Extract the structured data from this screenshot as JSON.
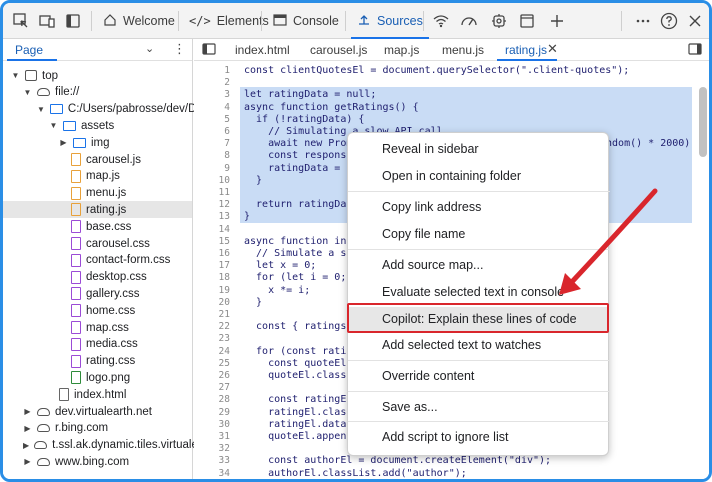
{
  "toolbar": {
    "tabs": [
      {
        "label": "Welcome",
        "icon": "home-icon"
      },
      {
        "label": "Elements",
        "icon": "code-icon"
      },
      {
        "label": "Console",
        "icon": "console-icon"
      },
      {
        "label": "Sources",
        "icon": "sources-icon"
      }
    ],
    "active_tab": "Sources"
  },
  "sidebar": {
    "page_label": "Page",
    "tree": [
      {
        "label": "top",
        "type": "frame",
        "depth": 0,
        "expanded": true
      },
      {
        "label": "file://",
        "type": "cloud",
        "depth": 1,
        "expanded": true
      },
      {
        "label": "C:/Users/pabrosse/dev/Demo",
        "type": "folder",
        "depth": 2,
        "expanded": true
      },
      {
        "label": "assets",
        "type": "folder",
        "depth": 3,
        "expanded": true
      },
      {
        "label": "img",
        "type": "folder",
        "depth": 4,
        "expanded": false
      },
      {
        "label": "carousel.js",
        "type": "js",
        "depth": 5
      },
      {
        "label": "map.js",
        "type": "js",
        "depth": 5
      },
      {
        "label": "menu.js",
        "type": "js",
        "depth": 5
      },
      {
        "label": "rating.js",
        "type": "js",
        "depth": 5,
        "selected": true
      },
      {
        "label": "base.css",
        "type": "css",
        "depth": 5
      },
      {
        "label": "carousel.css",
        "type": "css",
        "depth": 5
      },
      {
        "label": "contact-form.css",
        "type": "css",
        "depth": 5
      },
      {
        "label": "desktop.css",
        "type": "css",
        "depth": 5
      },
      {
        "label": "gallery.css",
        "type": "css",
        "depth": 5
      },
      {
        "label": "home.css",
        "type": "css",
        "depth": 5
      },
      {
        "label": "map.css",
        "type": "css",
        "depth": 5
      },
      {
        "label": "media.css",
        "type": "css",
        "depth": 5
      },
      {
        "label": "rating.css",
        "type": "css",
        "depth": 5
      },
      {
        "label": "logo.png",
        "type": "img",
        "depth": 5
      },
      {
        "label": "index.html",
        "type": "html",
        "depth": 4
      },
      {
        "label": "dev.virtualearth.net",
        "type": "cloud",
        "depth": 1,
        "expanded": false
      },
      {
        "label": "r.bing.com",
        "type": "cloud",
        "depth": 1,
        "expanded": false
      },
      {
        "label": "t.ssl.ak.dynamic.tiles.virtualearth",
        "type": "cloud",
        "depth": 1,
        "expanded": false
      },
      {
        "label": "www.bing.com",
        "type": "cloud",
        "depth": 1,
        "expanded": false
      }
    ]
  },
  "editor": {
    "file_tabs": [
      "index.html",
      "carousel.js",
      "map.js",
      "menu.js",
      "rating.js"
    ],
    "active_file": "rating.js",
    "lines": [
      {
        "n": "1",
        "text": "const clientQuotesEl = document.querySelector(\".client-quotes\");"
      },
      {
        "n": "2",
        "text": ""
      },
      {
        "n": "3",
        "text": "let ratingData = null;"
      },
      {
        "n": "4",
        "text": "async function getRatings() {"
      },
      {
        "n": "5",
        "text": "  if (!ratingData) {"
      },
      {
        "n": "6",
        "text": "    // Simulating a slow API call"
      },
      {
        "n": "7",
        "text": "    await new Promi"
      },
      {
        "n": "8",
        "text": "    const response"
      },
      {
        "n": "9",
        "text": "    ratingData = aw"
      },
      {
        "n": "10",
        "text": "  }"
      },
      {
        "n": "11",
        "text": ""
      },
      {
        "n": "12",
        "text": "  return ratingData"
      },
      {
        "n": "13",
        "text": "}"
      },
      {
        "n": "14",
        "text": ""
      },
      {
        "n": "15",
        "text": "async function init"
      },
      {
        "n": "16",
        "text": "  // Simulate a scr"
      },
      {
        "n": "17",
        "text": "  let x = 0;"
      },
      {
        "n": "18",
        "text": "  for (let i = 0; i"
      },
      {
        "n": "19",
        "text": "    x *= i;"
      },
      {
        "n": "20",
        "text": "  }"
      },
      {
        "n": "21",
        "text": ""
      },
      {
        "n": "22",
        "text": "  const { ratings }"
      },
      {
        "n": "23",
        "text": ""
      },
      {
        "n": "24",
        "text": "  for (const rating"
      },
      {
        "n": "25",
        "text": "    const quoteEl ="
      },
      {
        "n": "26",
        "text": "    quoteEl.classLi"
      },
      {
        "n": "27",
        "text": ""
      },
      {
        "n": "28",
        "text": "    const ratingEl"
      },
      {
        "n": "29",
        "text": "    ratingEl.classL"
      },
      {
        "n": "30",
        "text": "    ratingEl.datase"
      },
      {
        "n": "31",
        "text": "    quoteEl.appendC"
      },
      {
        "n": "32",
        "text": ""
      },
      {
        "n": "33",
        "text": "    const authorEl = document.createElement(\"div\");"
      },
      {
        "n": "34",
        "text": "    authorEl.classList.add(\"author\");"
      }
    ],
    "line7_suffix": "andom() * 2000));"
  },
  "context_menu": {
    "items": [
      "Reveal in sidebar",
      "Open in containing folder",
      "Copy link address",
      "Copy file name",
      "Add source map...",
      "Evaluate selected text in console",
      "Copilot: Explain these lines of code",
      "Add selected text to watches",
      "Override content",
      "Save as...",
      "Add script to ignore list"
    ],
    "highlighted": "Copilot: Explain these lines of code"
  },
  "colors": {
    "accent": "#1a73e8",
    "selection": "#c9dcf5",
    "annotation_red": "#d9262c"
  }
}
